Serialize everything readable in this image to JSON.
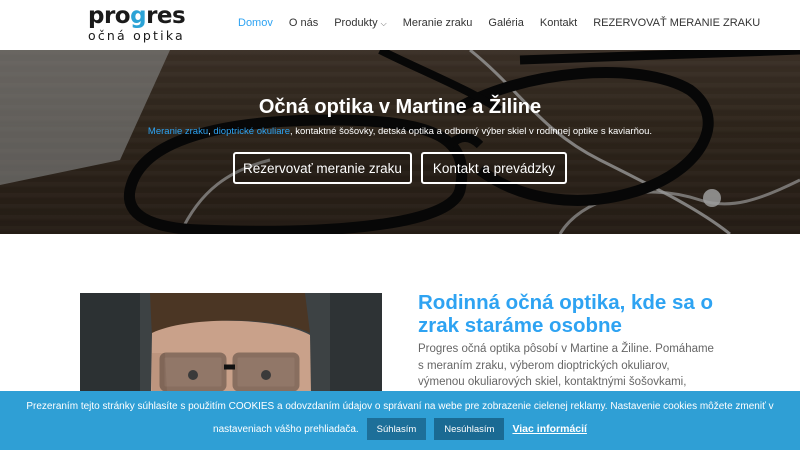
{
  "header": {
    "logo_main_a": "pro",
    "logo_main_b": "g",
    "logo_main_c": "res",
    "logo_sub": "očná optika",
    "nav": [
      {
        "label": "Domov"
      },
      {
        "label": "O nás"
      },
      {
        "label": "Produkty"
      },
      {
        "label": "Meranie zraku"
      },
      {
        "label": "Galéria"
      },
      {
        "label": "Kontakt"
      },
      {
        "label": "REZERVOVAŤ MERANIE ZRAKU"
      }
    ]
  },
  "hero": {
    "title": "Očná optika v Martine a Žiline",
    "sub_link1": "Meranie zraku",
    "sub_sep1": ", ",
    "sub_link2": "dioptrické okuliare",
    "sub_rest": ", kontaktné šošovky, detská optika a odborný výber skiel v rodinnej optike s kaviarňou.",
    "button1": "Rezervovať meranie zraku",
    "button2": "Kontakt a prevádzky"
  },
  "content": {
    "heading": "Rodinná očná optika, kde sa o zrak staráme osobne",
    "paragraph": "Progres očná optika pôsobí v Martine a Žiline. Pomáhame s meraním zraku, výberom dioptrických okuliarov, výmenou okuliarových skiel, kontaktnými šošovkami, slnečnými"
  },
  "cookie": {
    "text1": "Prezeraním tejto stránky súhlasíte s použitím COOKIES a odovzdaním údajov o správaní na webe pre zobrazenie cielenej reklamy. Nastavenie cookies môžete zmeniť v",
    "text2": "nastaveniach vášho prehliadača.",
    "accept": "Súhlasím",
    "decline": "Nesúhlasím",
    "more": "Viac informácií"
  },
  "colors": {
    "accent": "#2ea3f2",
    "cookie_bg": "#2f9fd5",
    "logo_accent": "#2ba3d6"
  }
}
